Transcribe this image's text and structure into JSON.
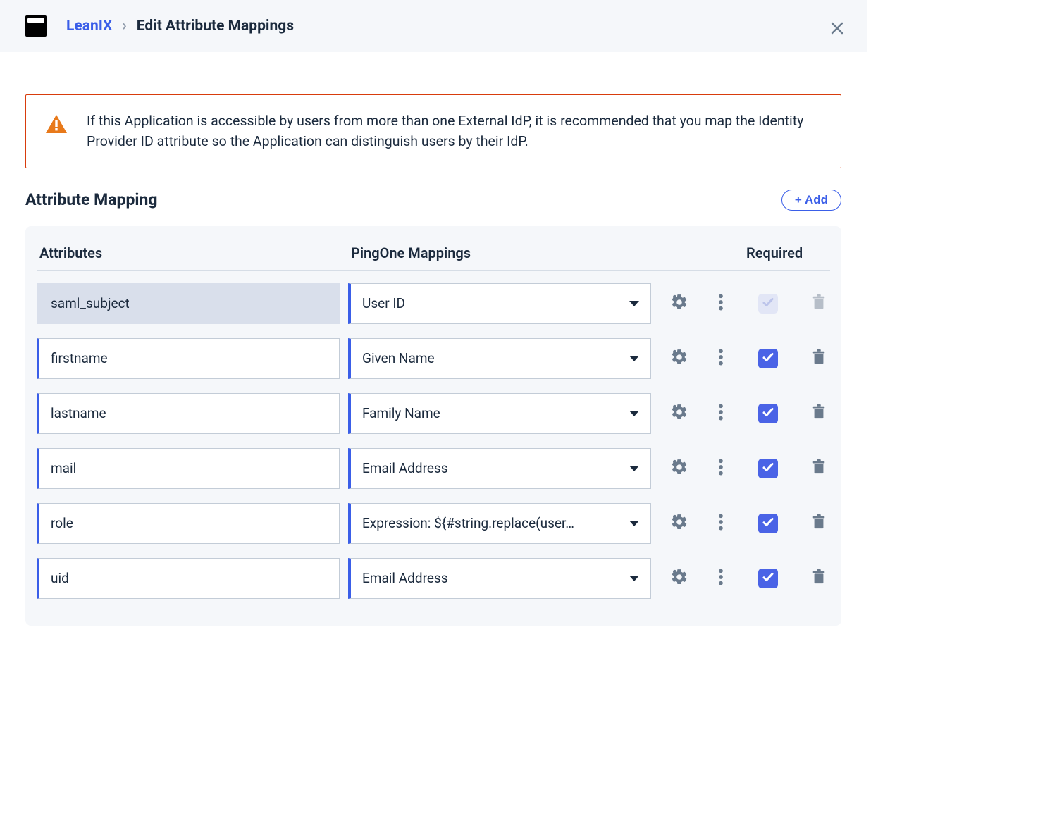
{
  "header": {
    "app_name": "LeanIX",
    "separator": "›",
    "page_title": "Edit Attribute Mappings"
  },
  "alert": {
    "text": "If this Application is accessible by users from more than one External IdP, it is recommended that you map the Identity Provider ID attribute so the Application can distinguish users by their IdP."
  },
  "section": {
    "title": "Attribute Mapping",
    "add_button": "+ Add"
  },
  "columns": {
    "attributes": "Attributes",
    "mappings": "PingOne Mappings",
    "required": "Required"
  },
  "rows": [
    {
      "attribute": "saml_subject",
      "mapping": "User ID",
      "locked": true,
      "required": true,
      "deletable": false
    },
    {
      "attribute": "firstname",
      "mapping": "Given Name",
      "locked": false,
      "required": true,
      "deletable": true
    },
    {
      "attribute": "lastname",
      "mapping": "Family Name",
      "locked": false,
      "required": true,
      "deletable": true
    },
    {
      "attribute": "mail",
      "mapping": "Email Address",
      "locked": false,
      "required": true,
      "deletable": true
    },
    {
      "attribute": "role",
      "mapping": "Expression: ${#string.replace(user…",
      "locked": false,
      "required": true,
      "deletable": true
    },
    {
      "attribute": "uid",
      "mapping": "Email Address",
      "locked": false,
      "required": true,
      "deletable": true
    }
  ]
}
